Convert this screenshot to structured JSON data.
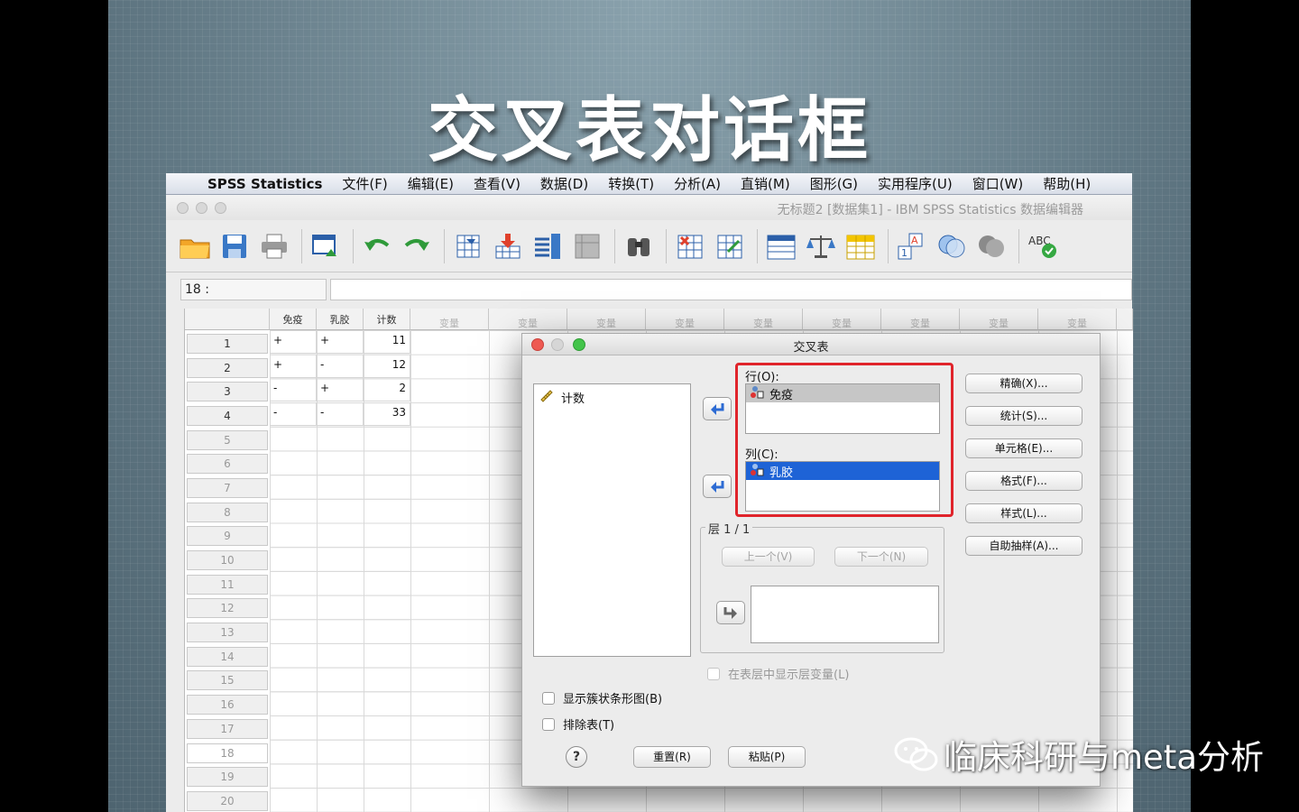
{
  "slide": {
    "title": "交叉表对话框"
  },
  "menubar": {
    "app_name": "SPSS Statistics",
    "items": [
      "文件(F)",
      "编辑(E)",
      "查看(V)",
      "数据(D)",
      "转换(T)",
      "分析(A)",
      "直销(M)",
      "图形(G)",
      "实用程序(U)",
      "窗口(W)",
      "帮助(H)"
    ]
  },
  "window": {
    "title": "无标题2 [数据集1] - IBM SPSS Statistics 数据编辑器"
  },
  "toolbar": {
    "icons": [
      "open-folder-icon",
      "save-icon",
      "print-icon",
      "dialog-recall-icon",
      "undo-icon",
      "redo-icon",
      "goto-case-icon",
      "goto-variable-icon",
      "variables-icon",
      "run-descriptives-icon",
      "find-icon",
      "insert-cases-icon",
      "insert-variable-icon",
      "split-file-icon",
      "weight-cases-icon",
      "select-cases-icon",
      "value-labels-icon",
      "use-sets-icon",
      "show-all-variables-icon",
      "spell-check-icon"
    ]
  },
  "editor": {
    "cell_ref": "18 :",
    "cell_value": ""
  },
  "grid": {
    "columns": [
      "免疫",
      "乳胶",
      "计数",
      "变量",
      "变量",
      "变量",
      "变量",
      "变量",
      "变量",
      "变量",
      "变量",
      "变量",
      "变量"
    ],
    "rows": [
      [
        "+",
        "+",
        "11"
      ],
      [
        "+",
        "-",
        "12"
      ],
      [
        "-",
        "+",
        "2"
      ],
      [
        "-",
        "-",
        "33"
      ]
    ],
    "row_numbers": [
      "1",
      "2",
      "3",
      "4",
      "5",
      "6",
      "7",
      "8",
      "9",
      "10",
      "11",
      "12",
      "13",
      "14",
      "15",
      "16",
      "17",
      "18",
      "19",
      "20"
    ]
  },
  "dialog": {
    "title": "交叉表",
    "source_variables": [
      "计数"
    ],
    "row_label": "行(O):",
    "row_items": [
      "免疫"
    ],
    "col_label": "列(C):",
    "col_items": [
      "乳胶"
    ],
    "layer_label": "层 1 / 1",
    "prev_button": "上一个(V)",
    "next_button": "下一个(N)",
    "show_layer_check": "在表层中显示层变量(L)",
    "side_buttons": [
      "精确(X)...",
      "统计(S)...",
      "单元格(E)...",
      "格式(F)...",
      "样式(L)...",
      "自助抽样(A)..."
    ],
    "clustered_bar_check": "显示簇状条形图(B)",
    "suppress_tables_check": "排除表(T)",
    "help": "?",
    "reset_button": "重置(R)",
    "paste_button": "粘贴(P)"
  },
  "watermark": {
    "text": "临床科研与meta分析"
  }
}
